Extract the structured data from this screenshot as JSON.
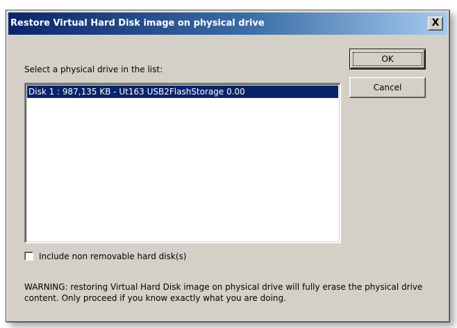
{
  "dialog": {
    "title": "Restore Virtual Hard Disk image on physical drive",
    "close_glyph": "X",
    "prompt": "Select a physical drive in the list:",
    "drives": [
      {
        "label": "Disk 1 : 987,135 KB - Ut163 USB2FlashStorage 0.00",
        "selected": true
      }
    ],
    "buttons": {
      "ok_label": "OK",
      "cancel_label": "Cancel"
    },
    "checkbox": {
      "label": "Include non removable hard disk(s)",
      "checked": false
    },
    "warning": "WARNING: restoring Virtual Hard Disk image on physical drive will fully erase the physical drive content. Only proceed if you know exactly what you are doing."
  },
  "colors": {
    "titlebar_start": "#0a246a",
    "titlebar_end": "#a6caf0",
    "selection": "#0a246a",
    "dialog_bg": "#d4d0c8"
  }
}
